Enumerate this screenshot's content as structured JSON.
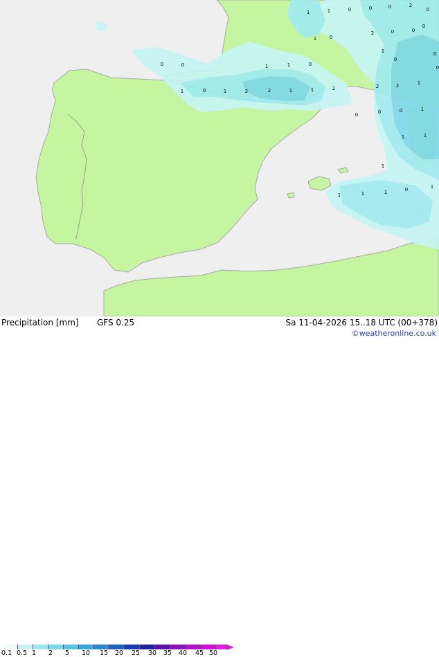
{
  "map": {
    "region": "Iberian Peninsula and Western Mediterranean",
    "colors": {
      "sea": "#efefef",
      "land": "#c5f5a0",
      "coast": "#a8a8a8",
      "border": "#8a8a8a",
      "precip_light": "#c5f5f5",
      "precip_low": "#a0eaf0",
      "precip_mid": "#7fd8e8",
      "precip_high": "#5cc3e0"
    },
    "labels": [
      {
        "text": "1"
      },
      {
        "text": "1"
      },
      {
        "text": "0"
      },
      {
        "text": "0"
      },
      {
        "text": "0"
      },
      {
        "text": "2"
      },
      {
        "text": "0"
      },
      {
        "text": "1"
      },
      {
        "text": "0"
      },
      {
        "text": "2"
      },
      {
        "text": "0"
      },
      {
        "text": "0"
      },
      {
        "text": "0"
      },
      {
        "text": "0"
      },
      {
        "text": "1"
      },
      {
        "text": "0"
      },
      {
        "text": "0"
      },
      {
        "text": "0"
      },
      {
        "text": "0"
      },
      {
        "text": "1"
      },
      {
        "text": "1"
      },
      {
        "text": "0"
      },
      {
        "text": "2"
      },
      {
        "text": "2"
      },
      {
        "text": "1"
      },
      {
        "text": "1"
      },
      {
        "text": "0"
      },
      {
        "text": "1"
      },
      {
        "text": "2"
      },
      {
        "text": "2"
      },
      {
        "text": "1"
      },
      {
        "text": "1"
      },
      {
        "text": "2"
      },
      {
        "text": "0"
      },
      {
        "text": "0"
      },
      {
        "text": "0"
      },
      {
        "text": "1"
      },
      {
        "text": "1"
      },
      {
        "text": "1"
      },
      {
        "text": "1"
      },
      {
        "text": "1"
      },
      {
        "text": "1"
      },
      {
        "text": "1"
      },
      {
        "text": "0"
      },
      {
        "text": "1"
      }
    ]
  },
  "footer": {
    "title": "Precipitation [mm]",
    "model": "GFS 0.25",
    "datetime": "Sa 11-04-2026 15..18 UTC (00+378)",
    "credit": "©weatheronline.co.uk"
  },
  "legend": {
    "colors": [
      "#f0fafa",
      "#c8f0f5",
      "#a0e6f0",
      "#7dd6e8",
      "#5cc3e0",
      "#3aa8d8",
      "#2b86cc",
      "#2060c0",
      "#1a3cb0",
      "#2020a0",
      "#5a10b0",
      "#8a10c0",
      "#b010c8",
      "#d010d0",
      "#e020e0"
    ],
    "ticks": [
      "0.1",
      "0.5",
      "1",
      "2",
      "5",
      "10",
      "15",
      "20",
      "25",
      "30",
      "35",
      "40",
      "45",
      "50"
    ]
  }
}
